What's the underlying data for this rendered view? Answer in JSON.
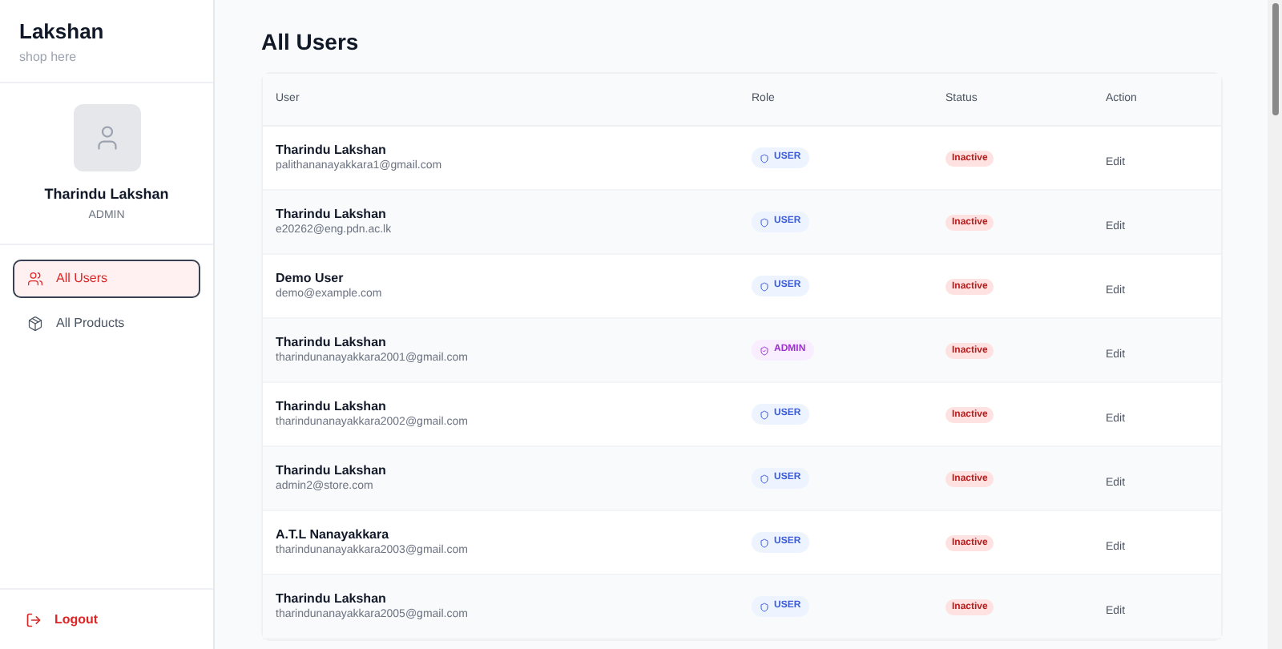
{
  "sidebar": {
    "brand": "Lakshan",
    "tagline": "shop here",
    "profile": {
      "name": "Tharindu Lakshan",
      "role": "ADMIN"
    },
    "items": [
      {
        "label": "All Users",
        "selected": true
      },
      {
        "label": "All Products",
        "selected": false
      }
    ],
    "logout": "Logout"
  },
  "page_title": "All Users",
  "table": {
    "columns": [
      "User",
      "Role",
      "Status",
      "Action"
    ],
    "rows": [
      {
        "name": "Tharindu Lakshan",
        "email": "palithananayakkara1@gmail.com",
        "role": "USER",
        "kind": "user",
        "status": "Inactive",
        "action": "Edit"
      },
      {
        "name": "Tharindu Lakshan",
        "email": "e20262@eng.pdn.ac.lk",
        "role": "USER",
        "kind": "user",
        "status": "Inactive",
        "action": "Edit"
      },
      {
        "name": "Demo User",
        "email": "demo@example.com",
        "role": "USER",
        "kind": "user",
        "status": "Inactive",
        "action": "Edit"
      },
      {
        "name": "Tharindu Lakshan",
        "email": "tharindunanayakkara2001@gmail.com",
        "role": "ADMIN",
        "kind": "admin",
        "status": "Inactive",
        "action": "Edit"
      },
      {
        "name": "Tharindu Lakshan",
        "email": "tharindunanayakkara2002@gmail.com",
        "role": "USER",
        "kind": "user",
        "status": "Inactive",
        "action": "Edit"
      },
      {
        "name": "Tharindu Lakshan",
        "email": "admin2@store.com",
        "role": "USER",
        "kind": "user",
        "status": "Inactive",
        "action": "Edit"
      },
      {
        "name": "A.T.L Nanayakkara",
        "email": "tharindunanayakkara2003@gmail.com",
        "role": "USER",
        "kind": "user",
        "status": "Inactive",
        "action": "Edit"
      },
      {
        "name": "Tharindu Lakshan",
        "email": "tharindunanayakkara2005@gmail.com",
        "role": "USER",
        "kind": "user",
        "status": "Inactive",
        "action": "Edit"
      }
    ]
  }
}
